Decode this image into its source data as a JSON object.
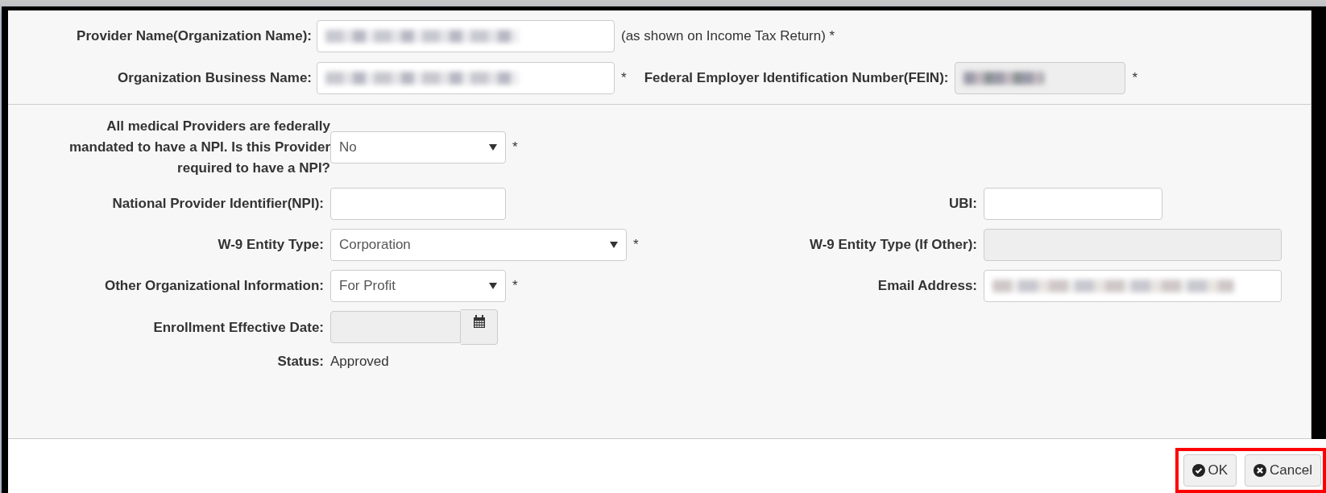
{
  "top_rows": [
    {
      "label": "Provider Name(Organization Name):",
      "field": {
        "disabled": false,
        "obscured": true
      },
      "suffix": "(as shown on Income Tax Return) *"
    },
    {
      "label": "Organization Business Name:",
      "field": {
        "disabled": false,
        "obscured": true
      },
      "suffix": "*",
      "extra": {
        "label": "Federal Employer Identification Number(FEIN):",
        "field": {
          "disabled": true,
          "obscured": true
        },
        "suffix": "*"
      }
    }
  ],
  "npi_question": {
    "label": "All medical Providers are federally mandated to have a NPI. Is this Provider required to have a NPI?",
    "value": "No",
    "suffix": "*"
  },
  "rows": [
    {
      "left": {
        "kind": "text",
        "label": "National Provider Identifier(NPI):",
        "disabled": false,
        "obscured": false
      },
      "right": {
        "kind": "text",
        "label": "UBI:",
        "disabled": false,
        "obscured": false,
        "wide": false
      }
    },
    {
      "left": {
        "kind": "select",
        "wide": true,
        "label": "W-9 Entity Type:",
        "value": "Corporation",
        "suffix": "*"
      },
      "right": {
        "kind": "text",
        "label": "W-9 Entity Type (If Other):",
        "disabled": true,
        "obscured": false,
        "wide": true
      }
    },
    {
      "left": {
        "kind": "select",
        "wide": false,
        "label": "Other Organizational Information:",
        "value": "For Profit",
        "suffix": "*"
      },
      "right": {
        "kind": "text",
        "label": "Email Address:",
        "disabled": false,
        "obscured": true,
        "wide": true
      }
    },
    {
      "left": {
        "kind": "date",
        "label": "Enrollment Effective Date:",
        "disabled": true
      }
    },
    {
      "left": {
        "kind": "static",
        "label": "Status:",
        "value": "Approved"
      }
    }
  ],
  "buttons": [
    {
      "kind": "ok",
      "label": "OK"
    },
    {
      "kind": "cancel",
      "label": "Cancel"
    }
  ]
}
